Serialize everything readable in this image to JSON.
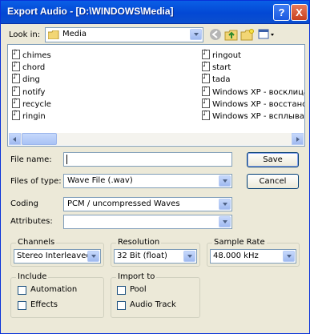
{
  "window": {
    "title": "Export Audio - [D:\\WINDOWS\\Media]",
    "help_label": "?",
    "close_label": "X"
  },
  "lookin": {
    "label": "Look in:",
    "value": "Media"
  },
  "files": {
    "column1": [
      "chimes",
      "chord",
      "ding",
      "notify",
      "recycle",
      "ringin"
    ],
    "column2": [
      "ringout",
      "start",
      "tada",
      "Windows XP - восклицани",
      "Windows XP - восстановл",
      "Windows XP - всплывающ"
    ]
  },
  "form": {
    "filename_label": "File name:",
    "filename_value": "",
    "filetype_label": "Files of type:",
    "filetype_value": "Wave File (.wav)",
    "coding_label": "Coding",
    "coding_value": "PCM / uncompressed Waves",
    "attributes_label": "Attributes:",
    "attributes_value": ""
  },
  "buttons": {
    "save_label": "Save",
    "cancel_label": "Cancel"
  },
  "channels": {
    "legend": "Channels",
    "value": "Stereo Interleaved"
  },
  "resolution": {
    "legend": "Resolution",
    "value": "32 Bit (float)"
  },
  "samplerate": {
    "legend": "Sample Rate",
    "value": "48.000 kHz"
  },
  "include": {
    "legend": "Include",
    "automation_label": "Automation",
    "effects_label": "Effects",
    "automation_checked": false,
    "effects_checked": false
  },
  "importto": {
    "legend": "Import to",
    "pool_label": "Pool",
    "audiotrack_label": "Audio Track",
    "pool_checked": false,
    "audiotrack_checked": false
  },
  "colors": {
    "titlebar": "#0348d4",
    "dialog_bg": "#ece9d8",
    "border": "#7f9db9"
  }
}
